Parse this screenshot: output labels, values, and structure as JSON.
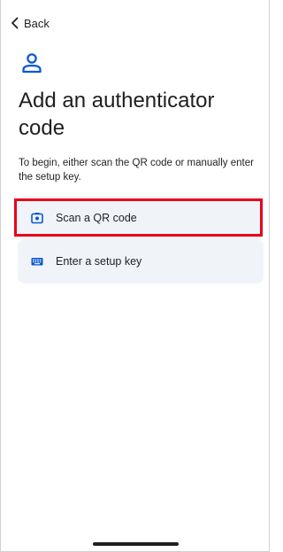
{
  "nav": {
    "back_label": "Back",
    "back_icon": "chevron-left-icon"
  },
  "header": {
    "icon": "account-icon",
    "title": "Add an authenticator code",
    "description": "To begin, either scan the QR code or manually enter the setup key."
  },
  "options": [
    {
      "label": "Scan a QR code",
      "icon": "camera-icon",
      "highlighted": true
    },
    {
      "label": "Enter a setup key",
      "icon": "keyboard-icon",
      "highlighted": false
    }
  ],
  "colors": {
    "accent": "#0b57d0",
    "option_background": "#f0f4f9",
    "highlight_border": "#e8001a",
    "text": "#1f1f1f"
  }
}
